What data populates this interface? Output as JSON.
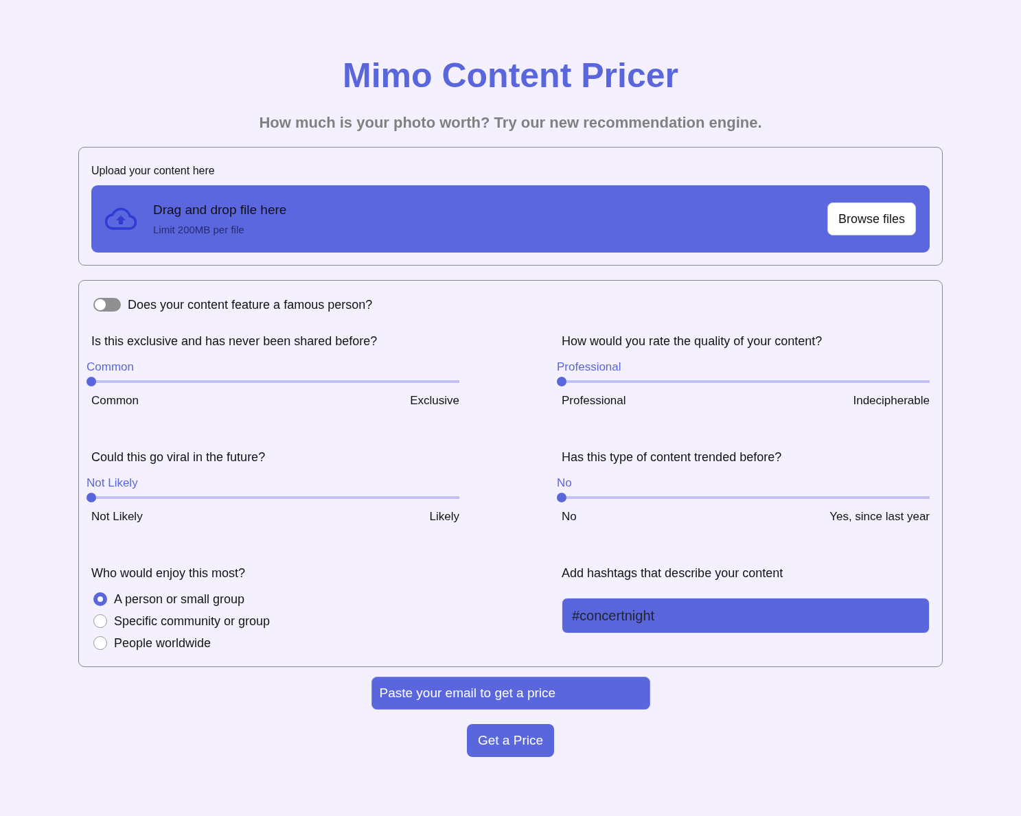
{
  "title": "Mimo Content Pricer",
  "subtitle": "How much is your photo worth? Try our new recommendation engine.",
  "upload": {
    "label": "Upload your content here",
    "dropzone_title": "Drag and drop file here",
    "dropzone_hint": "Limit 200MB per file",
    "button": "Browse files"
  },
  "form": {
    "toggle": {
      "label": "Does your content feature a famous person?",
      "on": false
    },
    "sliders": [
      {
        "question": "Is this exclusive and has never been shared before?",
        "value": "Common",
        "level": 0,
        "min_label": "Common",
        "max_label": "Exclusive"
      },
      {
        "question": "How would you rate the quality of your content?",
        "value": "Professional",
        "level": 0,
        "min_label": "Professional",
        "max_label": "Indecipherable"
      },
      {
        "question": "Could this go viral in the future?",
        "value": "Not Likely",
        "level": 0,
        "min_label": "Not Likely",
        "max_label": "Likely"
      },
      {
        "question": "Has this type of content trended before?",
        "value": "No",
        "level": 0,
        "min_label": "No",
        "max_label": "Yes, since last year"
      }
    ],
    "audience": {
      "question": "Who would enjoy this most?",
      "options": [
        {
          "label": "A person or small group",
          "selected": true
        },
        {
          "label": "Specific community or group",
          "selected": false
        },
        {
          "label": "People worldwide",
          "selected": false
        }
      ]
    },
    "hashtags": {
      "label": "Add hashtags that describe your content",
      "placeholder": "#concertnight"
    }
  },
  "email": {
    "placeholder": "Paste your email to get a price"
  },
  "submit": "Get a Price"
}
